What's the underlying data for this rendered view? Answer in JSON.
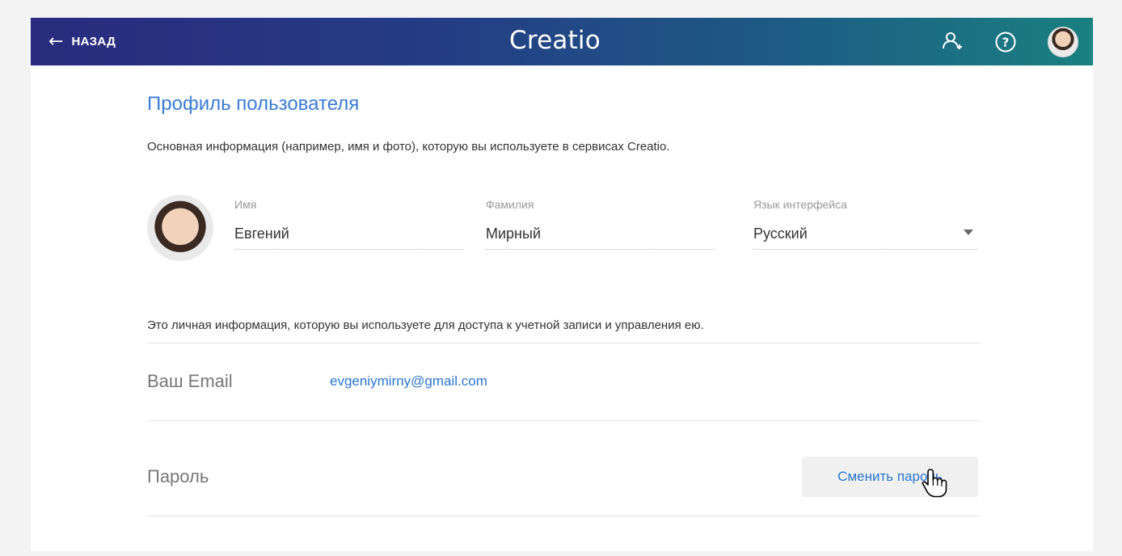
{
  "header": {
    "back_label": "НАЗАД",
    "logo_text": "Creatio",
    "icons": [
      "back-arrow-icon",
      "add-user-icon",
      "help-icon",
      "user-avatar"
    ],
    "colors": {
      "gradient_start": "#2a2b7e",
      "gradient_end": "#1a8080"
    }
  },
  "profile": {
    "title": "Профиль пользователя",
    "subtitle": "Основная информация (например, имя и фото), которую вы используете в сервисах Creatio.",
    "first_name": {
      "label": "Имя",
      "value": "Евгений"
    },
    "last_name": {
      "label": "Фамилия",
      "value": "Мирный"
    },
    "language": {
      "label": "Язык интерфейса",
      "value": "Русский"
    }
  },
  "account": {
    "info": "Это личная информация, которую вы используете для доступа к учетной записи и управления ею.",
    "email_label": "Ваш Email",
    "email_value": "evgeniymirny@gmail.com",
    "password_label": "Пароль",
    "change_password_button": "Сменить пароль"
  },
  "accent_color": "#2a76d2"
}
